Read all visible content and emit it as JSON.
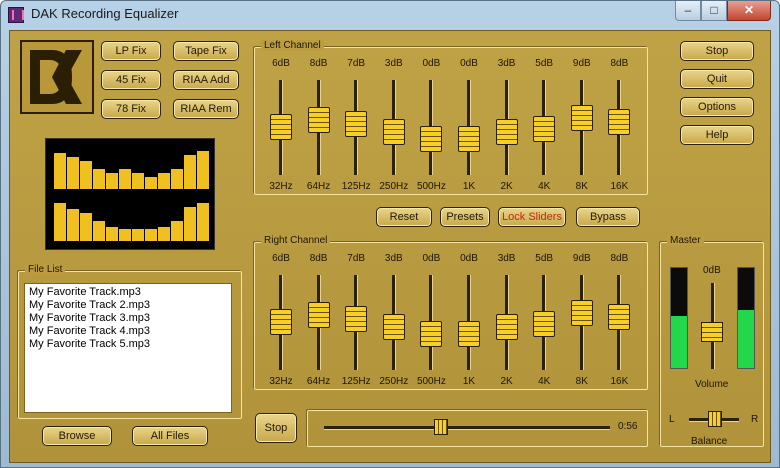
{
  "window": {
    "title": "DAK Recording Equalizer",
    "min_glyph": "–",
    "max_glyph": "□",
    "close_glyph": "✕"
  },
  "presets": [
    {
      "name": "lp-fix-button",
      "label": "LP Fix"
    },
    {
      "name": "tape-fix-button",
      "label": "Tape Fix"
    },
    {
      "name": "45-fix-button",
      "label": "45 Fix"
    },
    {
      "name": "riaa-add-button",
      "label": "RIAA Add"
    },
    {
      "name": "78-fix-button",
      "label": "78 Fix"
    },
    {
      "name": "riaa-rem-button",
      "label": "RIAA Rem"
    }
  ],
  "side_buttons": [
    {
      "name": "stop-button",
      "label": "Stop"
    },
    {
      "name": "quit-button",
      "label": "Quit"
    },
    {
      "name": "options-button",
      "label": "Options"
    },
    {
      "name": "help-button",
      "label": "Help"
    }
  ],
  "spectrum": {
    "top": [
      0.9,
      0.8,
      0.7,
      0.5,
      0.4,
      0.5,
      0.4,
      0.3,
      0.4,
      0.5,
      0.85,
      0.95
    ],
    "bottom": [
      0.95,
      0.8,
      0.7,
      0.5,
      0.35,
      0.3,
      0.3,
      0.3,
      0.35,
      0.5,
      0.85,
      0.95
    ]
  },
  "eq_labels": {
    "left_channel": "Left Channel",
    "right_channel": "Right Channel"
  },
  "bands": [
    {
      "freq": "32Hz",
      "gain": "6dB",
      "level": 0.62
    },
    {
      "freq": "64Hz",
      "gain": "8dB",
      "level": 0.72
    },
    {
      "freq": "125Hz",
      "gain": "7dB",
      "level": 0.66
    },
    {
      "freq": "250Hz",
      "gain": "3dB",
      "level": 0.55
    },
    {
      "freq": "500Hz",
      "gain": "0dB",
      "level": 0.45
    },
    {
      "freq": "1K",
      "gain": "0dB",
      "level": 0.45
    },
    {
      "freq": "2K",
      "gain": "3dB",
      "level": 0.55
    },
    {
      "freq": "4K",
      "gain": "5dB",
      "level": 0.6
    },
    {
      "freq": "8K",
      "gain": "9dB",
      "level": 0.76
    },
    {
      "freq": "16K",
      "gain": "8dB",
      "level": 0.7
    }
  ],
  "mid_buttons": [
    {
      "name": "reset-button",
      "label": "Reset",
      "color": ""
    },
    {
      "name": "presets-button",
      "label": "Presets",
      "color": ""
    },
    {
      "name": "lock-sliders-button",
      "label": "Lock Sliders",
      "color": "#c0271a"
    },
    {
      "name": "bypass-button",
      "label": "Bypass",
      "color": ""
    }
  ],
  "file_list": {
    "title": "File List",
    "items": [
      "My Favorite Track.mp3",
      "My Favorite Track 2.mp3",
      "My Favorite Track 3.mp3",
      "My Favorite Track 4.mp3",
      "My Favorite Track 5.mp3"
    ],
    "browse_label": "Browse",
    "all_files_label": "All Files"
  },
  "transport": {
    "stop_label": "Stop",
    "time": "0:56",
    "position": 0.41
  },
  "master": {
    "title": "Master",
    "gain": "0dB",
    "volume_label": "Volume",
    "volume_level": 0.55,
    "left_meter": 0.52,
    "right_meter": 0.58,
    "balance_label": "Balance",
    "balance_left": "L",
    "balance_right": "R",
    "balance": 0.52
  }
}
